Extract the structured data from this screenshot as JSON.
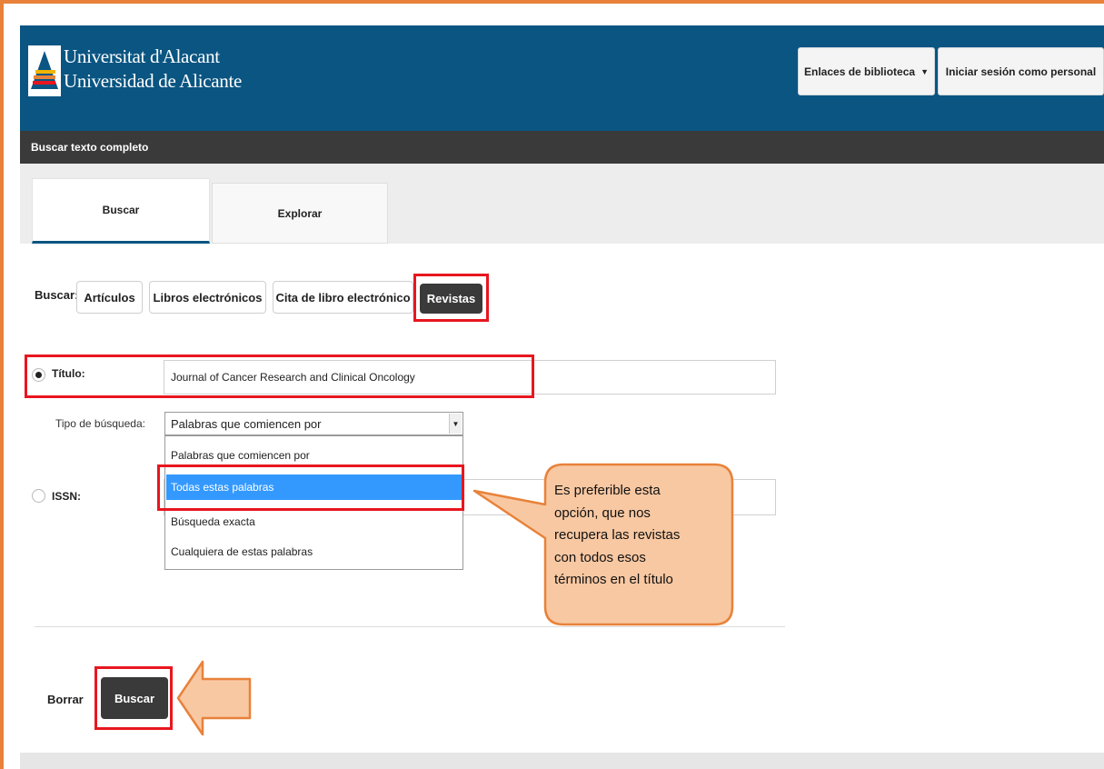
{
  "header": {
    "brand_line1": "Universitat d'Alacant",
    "brand_line2": "Universidad de Alicante",
    "library_links_label": "Enlaces de biblioteca",
    "library_links_caret": "▼",
    "login_label": "Iniciar sesión como personal"
  },
  "subbar": {
    "title": "Buscar texto completo"
  },
  "tabs": [
    {
      "label": "Buscar",
      "active": true
    },
    {
      "label": "Explorar",
      "active": false
    }
  ],
  "search_types": {
    "label": "Buscar:",
    "options": [
      "Artículos",
      "Libros electrónicos",
      "Cita de libro electrónico",
      "Revistas"
    ],
    "selected": "Revistas"
  },
  "form": {
    "titulo_label": "Título:",
    "titulo_value": "Journal of Cancer Research and Clinical Oncology",
    "tipo_label": "Tipo de búsqueda:",
    "tipo_selected": "Palabras que comiencen por",
    "tipo_options": [
      "Palabras que comiencen por",
      "Todas estas palabras",
      "Búsqueda exacta",
      "Cualquiera de estas palabras"
    ],
    "tipo_highlighted": "Todas estas palabras",
    "issn_label": "ISSN:",
    "issn_value": ""
  },
  "actions": {
    "clear_label": "Borrar",
    "search_label": "Buscar"
  },
  "callout": {
    "line1": "Es preferible esta",
    "line2": "opción, que nos",
    "line3": "recupera las revistas",
    "line4": "con todos esos",
    "line5": "términos en el título"
  },
  "colors": {
    "header_bg": "#0a5582",
    "subbar_bg": "#3a3a3a",
    "highlight_red": "#e8161f",
    "frame_orange": "#e8823a",
    "callout_fill": "#f8c8a2",
    "dropdown_highlight": "#3399ff"
  },
  "icons": {
    "logo": "university-logo-icon",
    "radio_checked": "radio-checked-icon",
    "radio_unchecked": "radio-unchecked-icon",
    "dropdown_arrow": "chevron-down-icon"
  }
}
